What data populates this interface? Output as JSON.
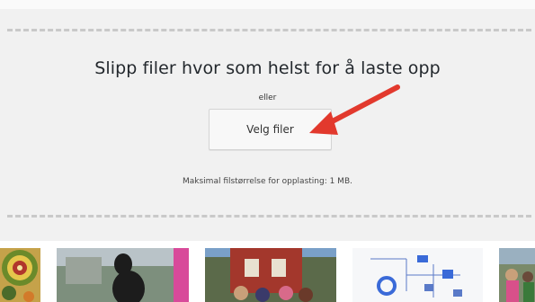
{
  "dropzone": {
    "title": "Slipp filer hvor som helst for å laste opp",
    "or_text": "eller",
    "select_button": "Velg filer",
    "max_size_text": "Maksimal filstørrelse for opplasting: 1 MB."
  },
  "colors": {
    "arrow": "#e2392d",
    "dropzone_bg": "#f1f1f1",
    "dash": "#c9c9c9"
  },
  "media_thumbnails": [
    {
      "id": "thumb-1",
      "icon": "image-icon"
    },
    {
      "id": "thumb-2",
      "icon": "image-icon"
    },
    {
      "id": "thumb-3",
      "icon": "image-icon"
    },
    {
      "id": "thumb-4",
      "icon": "image-icon"
    },
    {
      "id": "thumb-5",
      "icon": "image-icon"
    }
  ]
}
